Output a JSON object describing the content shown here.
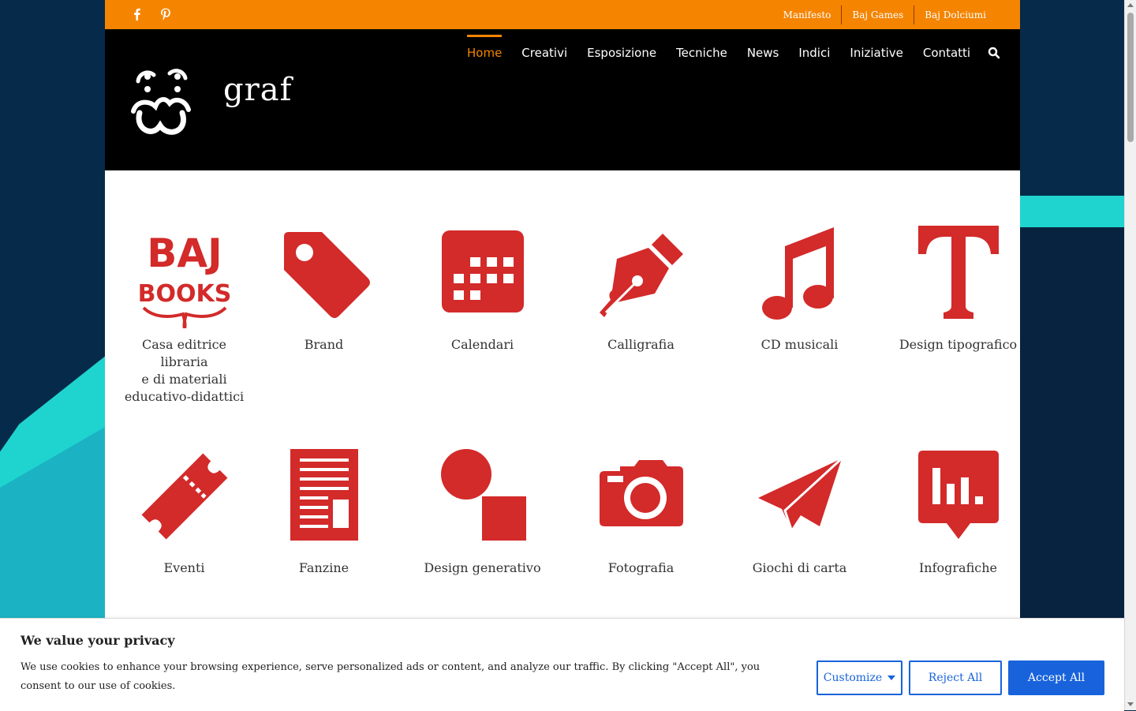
{
  "colors": {
    "accent": "#f58400",
    "icon_red": "#d32a2a",
    "header_bg": "#000000",
    "cookie_blue": "#1863dc"
  },
  "topbar": {
    "social": [
      "facebook-icon",
      "pinterest-icon"
    ],
    "links": [
      "Manifesto",
      "Baj Games",
      "Baj Dolciumi"
    ]
  },
  "header": {
    "logo_text": "graf",
    "nav": [
      "Home",
      "Creativi",
      "Esposizione",
      "Tecniche",
      "News",
      "Indici",
      "Iniziative",
      "Contatti"
    ],
    "active_nav": "Home",
    "search_icon": "search-icon"
  },
  "tiles": [
    {
      "label": "Casa editrice\nlibraria\ne di materiali\neducativo-didattici",
      "icon": "baj-books-logo",
      "logo_text": [
        "BAJ",
        "BOOKS"
      ]
    },
    {
      "label": "Brand",
      "icon": "tag-icon"
    },
    {
      "label": "Calendari",
      "icon": "calendar-icon"
    },
    {
      "label": "Calligrafia",
      "icon": "fountain-pen-icon"
    },
    {
      "label": "CD musicali",
      "icon": "music-note-icon"
    },
    {
      "label": "Design tipografico",
      "icon": "letter-t-icon"
    },
    {
      "label": "Eventi",
      "icon": "ticket-icon"
    },
    {
      "label": "Fanzine",
      "icon": "newspaper-icon"
    },
    {
      "label": "Design generativo",
      "icon": "shapes-icon"
    },
    {
      "label": "Fotografia",
      "icon": "camera-icon"
    },
    {
      "label": "Giochi di carta",
      "icon": "paper-plane-icon"
    },
    {
      "label": "Infografiche",
      "icon": "chart-bubble-icon"
    }
  ],
  "cookie": {
    "title": "We value your privacy",
    "text": "We use cookies to enhance your browsing experience, serve personalized ads or content, and analyze our traffic. By clicking \"Accept All\", you consent to our use of cookies.",
    "customize": "Customize",
    "reject": "Reject All",
    "accept": "Accept All"
  }
}
